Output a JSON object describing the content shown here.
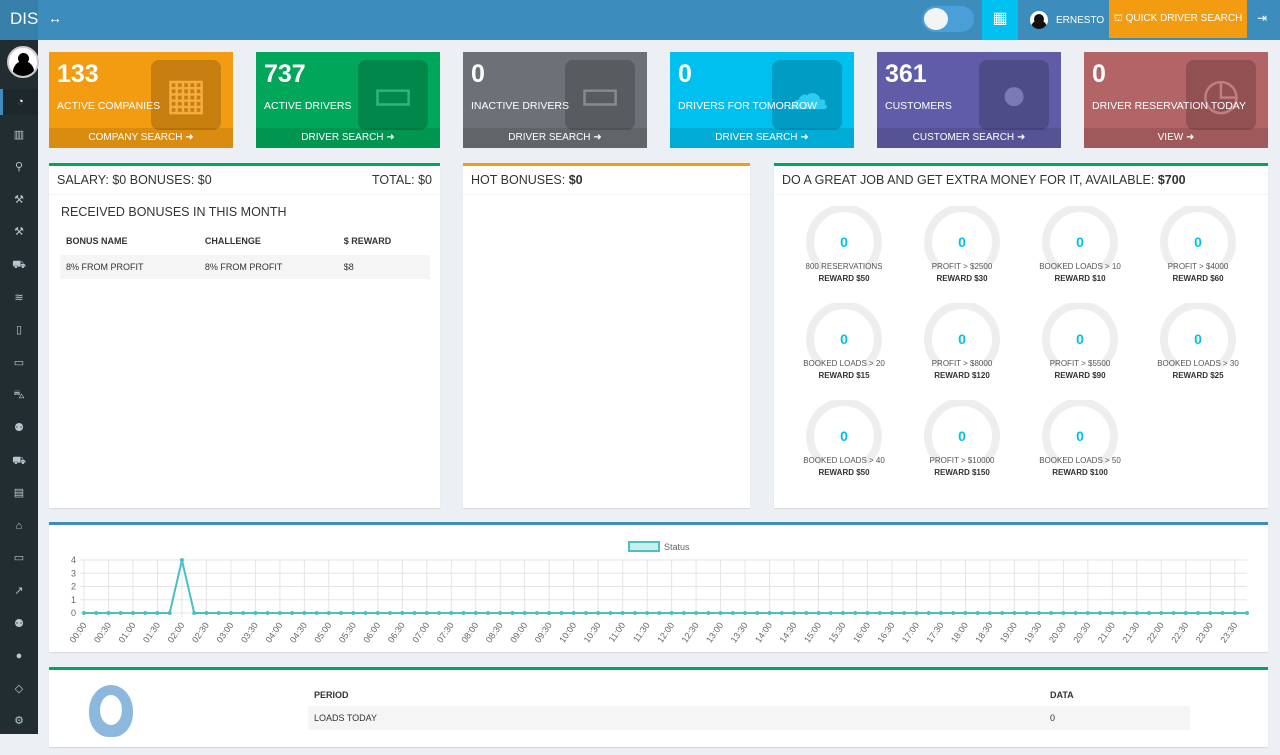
{
  "header": {
    "logo": "DISPATCH",
    "user_name": "ERNESTO",
    "quick_search": "QUICK DRIVER SEARCH"
  },
  "sidebar": {
    "icons": [
      "dashboard-icon",
      "bar-chart-icon",
      "search-icon",
      "hammer-icon",
      "gavel-icon",
      "truck-icon",
      "database-icon",
      "building-icon",
      "id-card-icon",
      "car-icon",
      "user-truck-icon",
      "truck-loading-icon",
      "document-icon",
      "bank-icon",
      "address-card-icon",
      "line-chart-icon",
      "user-tag-icon",
      "map-marker-icon",
      "diamond-icon",
      "cogs-icon"
    ],
    "glyphs": [
      "◔",
      "▥",
      "⚲",
      "⚒",
      "⚒",
      "⛟",
      "≋",
      "▯",
      "▭",
      "⛍",
      "⚉",
      "⛟",
      "▤",
      "⌂",
      "▭",
      "↗",
      "⚉",
      "●",
      "◇",
      "⚙"
    ]
  },
  "stat_boxes": [
    {
      "value": "133",
      "label": "ACTIVE COMPANIES",
      "link": "COMPANY SEARCH",
      "color": "#f39c12",
      "icon": "▦"
    },
    {
      "value": "737",
      "label": "ACTIVE DRIVERS",
      "link": "DRIVER SEARCH",
      "color": "#00a65a",
      "icon": "▭"
    },
    {
      "value": "0",
      "label": "INACTIVE DRIVERS",
      "link": "DRIVER SEARCH",
      "color": "#6b7177",
      "icon": "▭"
    },
    {
      "value": "0",
      "label": "DRIVERS FOR TOMORROW",
      "link": "DRIVER SEARCH",
      "color": "#00c0ef",
      "icon": "☁"
    },
    {
      "value": "361",
      "label": "CUSTOMERS",
      "link": "CUSTOMER SEARCH",
      "color": "#605ca8",
      "icon": "●"
    },
    {
      "value": "0",
      "label": "DRIVER RESERVATION TODAY",
      "link": "VIEW",
      "color": "#b26466",
      "icon": "◷"
    }
  ],
  "salary": {
    "left": "SALARY: $0 BONUSES: $0",
    "total": "TOTAL: $0",
    "subtitle": "RECEIVED BONUSES IN THIS MONTH",
    "columns": [
      "BONUS NAME",
      "CHALLENGE",
      "$ REWARD"
    ],
    "rows": [
      [
        "8% FROM PROFIT",
        "8% FROM PROFIT",
        "$8"
      ]
    ]
  },
  "hot": {
    "label": "HOT BONUSES:",
    "value": "$0"
  },
  "extra": {
    "label": "DO A GREAT JOB AND GET EXTRA MONEY FOR IT, AVAILABLE:",
    "value": "$700",
    "gauges": [
      {
        "value": "0",
        "label": "800 RESERVATIONS",
        "reward": "REWARD $50"
      },
      {
        "value": "0",
        "label": "PROFIT > $2500",
        "reward": "REWARD $30"
      },
      {
        "value": "0",
        "label": "BOOKED LOADS > 10",
        "reward": "REWARD $10"
      },
      {
        "value": "0",
        "label": "PROFIT > $4000",
        "reward": "REWARD $60"
      },
      {
        "value": "0",
        "label": "BOOKED LOADS > 20",
        "reward": "REWARD $15"
      },
      {
        "value": "0",
        "label": "PROFIT > $8000",
        "reward": "REWARD $120"
      },
      {
        "value": "0",
        "label": "PROFIT > $5500",
        "reward": "REWARD $90"
      },
      {
        "value": "0",
        "label": "BOOKED LOADS > 30",
        "reward": "REWARD $25"
      },
      {
        "value": "0",
        "label": "BOOKED LOADS > 40",
        "reward": "REWARD $50"
      },
      {
        "value": "0",
        "label": "PROFIT > $10000",
        "reward": "REWARD $150"
      },
      {
        "value": "0",
        "label": "BOOKED LOADS > 50",
        "reward": "REWARD $100"
      }
    ]
  },
  "chart_data": {
    "type": "line",
    "title": "",
    "legend": [
      "Status"
    ],
    "legend_position": "top",
    "ylim": [
      0,
      4
    ],
    "yticks": [
      0,
      1,
      2,
      3,
      4
    ],
    "grid": true,
    "color": "#4bc0c0",
    "x_interval_minutes": 15,
    "peak": {
      "x": "02:00",
      "y": 4
    },
    "series": [
      {
        "name": "Status",
        "values": [
          0,
          0,
          0,
          0,
          0,
          0,
          0,
          0,
          4,
          0,
          0,
          0,
          0,
          0,
          0,
          0,
          0,
          0,
          0,
          0,
          0,
          0,
          0,
          0,
          0,
          0,
          0,
          0,
          0,
          0,
          0,
          0,
          0,
          0,
          0,
          0,
          0,
          0,
          0,
          0,
          0,
          0,
          0,
          0,
          0,
          0,
          0,
          0,
          0,
          0,
          0,
          0,
          0,
          0,
          0,
          0,
          0,
          0,
          0,
          0,
          0,
          0,
          0,
          0,
          0,
          0,
          0,
          0,
          0,
          0,
          0,
          0,
          0,
          0,
          0,
          0,
          0,
          0,
          0,
          0,
          0,
          0,
          0,
          0,
          0,
          0,
          0,
          0,
          0,
          0,
          0,
          0,
          0,
          0,
          0,
          0
        ]
      }
    ]
  },
  "period": {
    "columns": [
      "PERIOD",
      "DATA"
    ],
    "rows": [
      [
        "LOADS TODAY",
        "0"
      ]
    ]
  }
}
